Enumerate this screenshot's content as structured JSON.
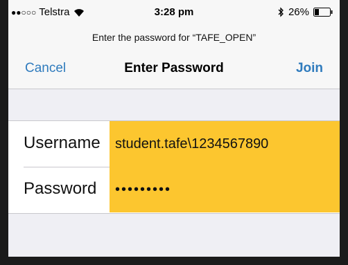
{
  "status_bar": {
    "carrier": "Telstra",
    "time": "3:28 pm",
    "battery": "26%",
    "icons": [
      "signal-dots-icon",
      "wifi-icon",
      "bluetooth-icon",
      "battery-icon"
    ]
  },
  "prompt": "Enter the password for “TAFE_OPEN”",
  "navbar": {
    "cancel_label": "Cancel",
    "title": "Enter Password",
    "join_label": "Join"
  },
  "form": {
    "username_label": "Username",
    "username_value": "student.tafe\\1234567890",
    "password_label": "Password",
    "password_value": "•••••••••"
  },
  "colors": {
    "accent": "#2f7bbd",
    "highlight": "#fcc62f"
  }
}
